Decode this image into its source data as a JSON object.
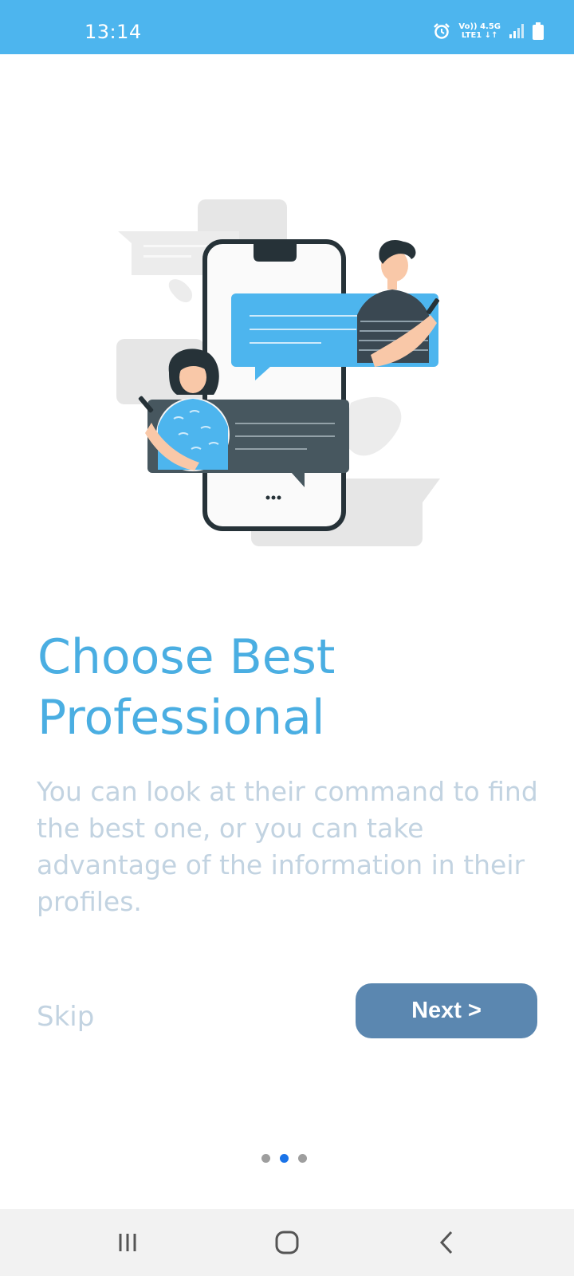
{
  "status_bar": {
    "time": "13:14",
    "network_top": "Vo)) 4.5G",
    "network_bottom": "LTE1 ↓↑",
    "icons": [
      "alarm-icon",
      "signal-icon",
      "battery-icon"
    ]
  },
  "onboarding": {
    "title": "Choose Best Professional",
    "description": "You can look at their command to find the best one, or you can take advantage of the information in their profiles.",
    "skip_label": "Skip",
    "next_label": "Next >",
    "page_count": 3,
    "current_page": 2
  },
  "nav_bar": {
    "icons": [
      "recent-apps-icon",
      "home-icon",
      "back-icon"
    ]
  },
  "colors": {
    "status_bar": "#4db5ee",
    "title": "#4aaee2",
    "muted_text": "#c2d3e1",
    "next_button": "#5b87b0",
    "active_dot": "#1a73e8",
    "chat_blue": "#4db5ee",
    "chat_dark": "#47575f"
  }
}
